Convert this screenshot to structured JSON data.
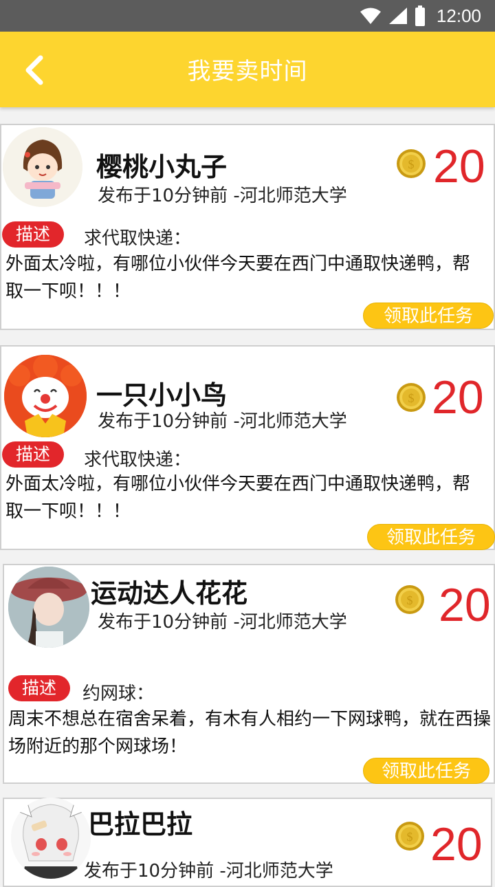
{
  "status": {
    "time": "12:00"
  },
  "header": {
    "title": "我要卖时间"
  },
  "colors": {
    "accent": "#fdd52f",
    "price": "#e0262a",
    "tag": "#e2262b",
    "button": "#fdc514"
  },
  "posts": [
    {
      "name": "樱桃小丸子",
      "meta": "发布于10分钟前 -河北师范大学",
      "price": "20",
      "tag": "描述",
      "request": "求代取快递：",
      "description": "外面太冷啦，有哪位小伙伴今天要在西门中通取快递鸭，帮取一下呗！！！",
      "button": "领取此任务",
      "avatar_icon": "girl-avatar-icon"
    },
    {
      "name": "一只小小鸟",
      "meta": "发布于10分钟前 -河北师范大学",
      "price": "20",
      "tag": "描述",
      "request": "求代取快递：",
      "description": "外面太冷啦，有哪位小伙伴今天要在西门中通取快递鸭，帮取一下呗！！！",
      "button": "领取此任务",
      "avatar_icon": "clown-avatar-icon"
    },
    {
      "name": "运动达人花花",
      "meta": "发布于10分钟前 -河北师范大学",
      "price": "20",
      "tag": "描述",
      "request": "约网球：",
      "description": "周末不想总在宿舍呆着，有木有人相约一下网球鸭，就在西操场附近的那个网球场！",
      "button": "领取此任务",
      "avatar_icon": "photo-avatar-icon"
    },
    {
      "name": "巴拉巴拉",
      "meta": "发布于10分钟前 -河北师范大学",
      "price": "20",
      "avatar_icon": "anime-avatar-icon"
    }
  ]
}
